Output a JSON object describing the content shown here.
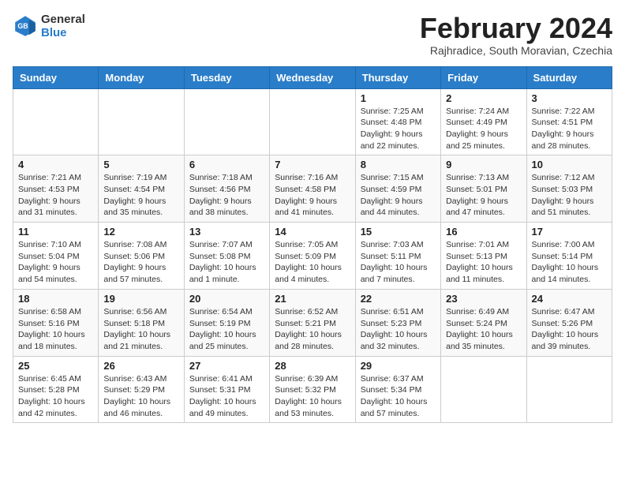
{
  "header": {
    "logo_line1": "General",
    "logo_line2": "Blue",
    "month_year": "February 2024",
    "location": "Rajhradice, South Moravian, Czechia"
  },
  "days_of_week": [
    "Sunday",
    "Monday",
    "Tuesday",
    "Wednesday",
    "Thursday",
    "Friday",
    "Saturday"
  ],
  "weeks": [
    [
      {
        "day": "",
        "info": ""
      },
      {
        "day": "",
        "info": ""
      },
      {
        "day": "",
        "info": ""
      },
      {
        "day": "",
        "info": ""
      },
      {
        "day": "1",
        "info": "Sunrise: 7:25 AM\nSunset: 4:48 PM\nDaylight: 9 hours\nand 22 minutes."
      },
      {
        "day": "2",
        "info": "Sunrise: 7:24 AM\nSunset: 4:49 PM\nDaylight: 9 hours\nand 25 minutes."
      },
      {
        "day": "3",
        "info": "Sunrise: 7:22 AM\nSunset: 4:51 PM\nDaylight: 9 hours\nand 28 minutes."
      }
    ],
    [
      {
        "day": "4",
        "info": "Sunrise: 7:21 AM\nSunset: 4:53 PM\nDaylight: 9 hours\nand 31 minutes."
      },
      {
        "day": "5",
        "info": "Sunrise: 7:19 AM\nSunset: 4:54 PM\nDaylight: 9 hours\nand 35 minutes."
      },
      {
        "day": "6",
        "info": "Sunrise: 7:18 AM\nSunset: 4:56 PM\nDaylight: 9 hours\nand 38 minutes."
      },
      {
        "day": "7",
        "info": "Sunrise: 7:16 AM\nSunset: 4:58 PM\nDaylight: 9 hours\nand 41 minutes."
      },
      {
        "day": "8",
        "info": "Sunrise: 7:15 AM\nSunset: 4:59 PM\nDaylight: 9 hours\nand 44 minutes."
      },
      {
        "day": "9",
        "info": "Sunrise: 7:13 AM\nSunset: 5:01 PM\nDaylight: 9 hours\nand 47 minutes."
      },
      {
        "day": "10",
        "info": "Sunrise: 7:12 AM\nSunset: 5:03 PM\nDaylight: 9 hours\nand 51 minutes."
      }
    ],
    [
      {
        "day": "11",
        "info": "Sunrise: 7:10 AM\nSunset: 5:04 PM\nDaylight: 9 hours\nand 54 minutes."
      },
      {
        "day": "12",
        "info": "Sunrise: 7:08 AM\nSunset: 5:06 PM\nDaylight: 9 hours\nand 57 minutes."
      },
      {
        "day": "13",
        "info": "Sunrise: 7:07 AM\nSunset: 5:08 PM\nDaylight: 10 hours\nand 1 minute."
      },
      {
        "day": "14",
        "info": "Sunrise: 7:05 AM\nSunset: 5:09 PM\nDaylight: 10 hours\nand 4 minutes."
      },
      {
        "day": "15",
        "info": "Sunrise: 7:03 AM\nSunset: 5:11 PM\nDaylight: 10 hours\nand 7 minutes."
      },
      {
        "day": "16",
        "info": "Sunrise: 7:01 AM\nSunset: 5:13 PM\nDaylight: 10 hours\nand 11 minutes."
      },
      {
        "day": "17",
        "info": "Sunrise: 7:00 AM\nSunset: 5:14 PM\nDaylight: 10 hours\nand 14 minutes."
      }
    ],
    [
      {
        "day": "18",
        "info": "Sunrise: 6:58 AM\nSunset: 5:16 PM\nDaylight: 10 hours\nand 18 minutes."
      },
      {
        "day": "19",
        "info": "Sunrise: 6:56 AM\nSunset: 5:18 PM\nDaylight: 10 hours\nand 21 minutes."
      },
      {
        "day": "20",
        "info": "Sunrise: 6:54 AM\nSunset: 5:19 PM\nDaylight: 10 hours\nand 25 minutes."
      },
      {
        "day": "21",
        "info": "Sunrise: 6:52 AM\nSunset: 5:21 PM\nDaylight: 10 hours\nand 28 minutes."
      },
      {
        "day": "22",
        "info": "Sunrise: 6:51 AM\nSunset: 5:23 PM\nDaylight: 10 hours\nand 32 minutes."
      },
      {
        "day": "23",
        "info": "Sunrise: 6:49 AM\nSunset: 5:24 PM\nDaylight: 10 hours\nand 35 minutes."
      },
      {
        "day": "24",
        "info": "Sunrise: 6:47 AM\nSunset: 5:26 PM\nDaylight: 10 hours\nand 39 minutes."
      }
    ],
    [
      {
        "day": "25",
        "info": "Sunrise: 6:45 AM\nSunset: 5:28 PM\nDaylight: 10 hours\nand 42 minutes."
      },
      {
        "day": "26",
        "info": "Sunrise: 6:43 AM\nSunset: 5:29 PM\nDaylight: 10 hours\nand 46 minutes."
      },
      {
        "day": "27",
        "info": "Sunrise: 6:41 AM\nSunset: 5:31 PM\nDaylight: 10 hours\nand 49 minutes."
      },
      {
        "day": "28",
        "info": "Sunrise: 6:39 AM\nSunset: 5:32 PM\nDaylight: 10 hours\nand 53 minutes."
      },
      {
        "day": "29",
        "info": "Sunrise: 6:37 AM\nSunset: 5:34 PM\nDaylight: 10 hours\nand 57 minutes."
      },
      {
        "day": "",
        "info": ""
      },
      {
        "day": "",
        "info": ""
      }
    ]
  ]
}
